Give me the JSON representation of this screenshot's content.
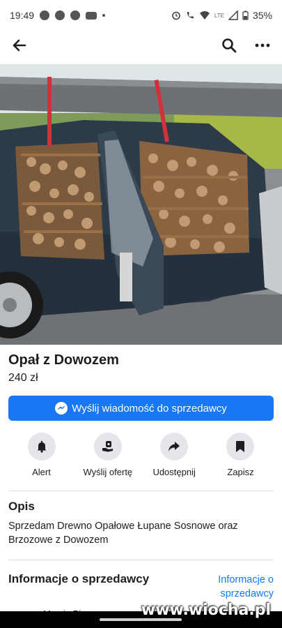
{
  "status_bar": {
    "time": "19:49",
    "battery": "35%",
    "network": "LTE"
  },
  "listing": {
    "title": "Opał z Dowozem",
    "price": "240 zł"
  },
  "message_button": {
    "label": "Wyślij wiadomość do sprzedawcy"
  },
  "actions": [
    {
      "label": "Alert",
      "icon": "bell-icon"
    },
    {
      "label": "Wyślij ofertę",
      "icon": "offer-hand-icon"
    },
    {
      "label": "Udostępnij",
      "icon": "share-arrow-icon"
    },
    {
      "label": "Zapisz",
      "icon": "bookmark-icon"
    }
  ],
  "description": {
    "heading": "Opis",
    "text": "Sprzedam Drewno Opałowe Łupane Sosnowe oraz Brzozowe z Dowozem"
  },
  "seller": {
    "heading": "Informacje o sprzedawcy",
    "link": "Informacje o sprzedawcy",
    "name_partial": "Marcin Pł"
  },
  "watermark": "www.wiocha.pl",
  "colors": {
    "accent": "#1877f2",
    "icon_bg": "#e4e6eb"
  }
}
